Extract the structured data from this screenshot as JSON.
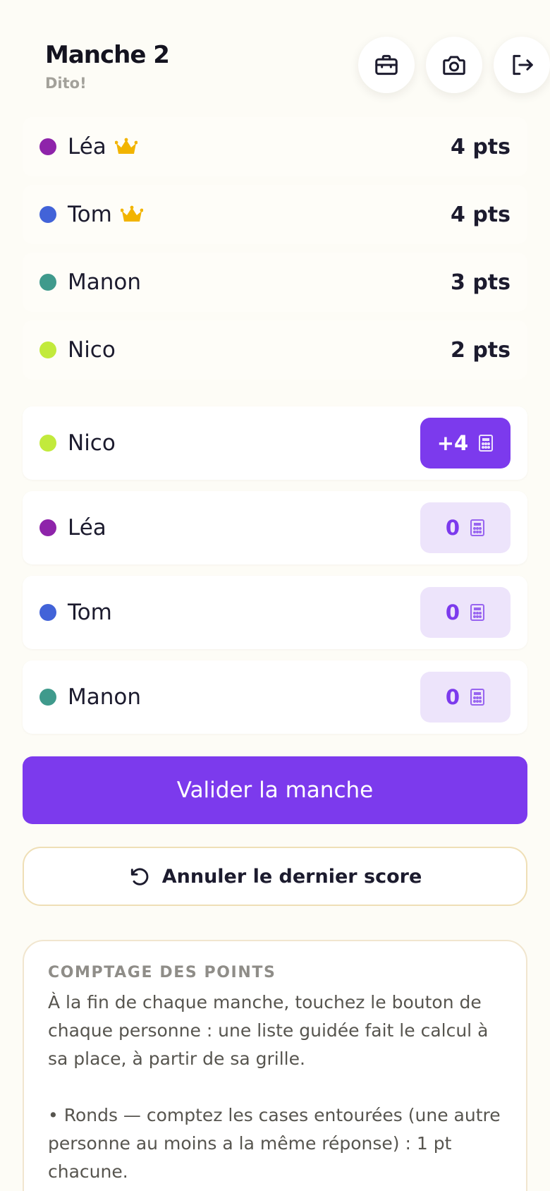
{
  "header": {
    "title": "Manche 2",
    "subtitle": "Dito!",
    "icons": [
      "briefcase-icon",
      "camera-icon",
      "exit-icon"
    ]
  },
  "ranking": [
    {
      "name": "Léa",
      "points": "4 pts",
      "color": "#8e24aa",
      "leader": true
    },
    {
      "name": "Tom",
      "points": "4 pts",
      "color": "#4263d8",
      "leader": true
    },
    {
      "name": "Manon",
      "points": "3 pts",
      "color": "#3f9a8c",
      "leader": false
    },
    {
      "name": "Nico",
      "points": "2 pts",
      "color": "#c2ea3c",
      "leader": false
    }
  ],
  "round_scores": [
    {
      "name": "Nico",
      "score": "+4",
      "color": "#c2ea3c",
      "active": true
    },
    {
      "name": "Léa",
      "score": "0",
      "color": "#8e24aa",
      "active": false
    },
    {
      "name": "Tom",
      "score": "0",
      "color": "#4263d8",
      "active": false
    },
    {
      "name": "Manon",
      "score": "0",
      "color": "#3f9a8c",
      "active": false
    }
  ],
  "actions": {
    "validate_label": "Valider la manche",
    "undo_label": "Annuler le dernier score"
  },
  "info": {
    "heading": "COMPTAGE DES POINTS",
    "paragraph1": "À la fin de chaque manche, touchez le bouton de chaque personne : une liste guidée fait le calcul à sa place, à partir de sa grille.",
    "paragraph2": "• Ronds — comptez les cases entourées (une autre personne au moins a la même réponse) : 1 pt chacune."
  },
  "colors": {
    "accent": "#7c3aed",
    "accent_soft": "#ede4fb",
    "crown": "#f2b400",
    "background": "#fdfcf6"
  }
}
